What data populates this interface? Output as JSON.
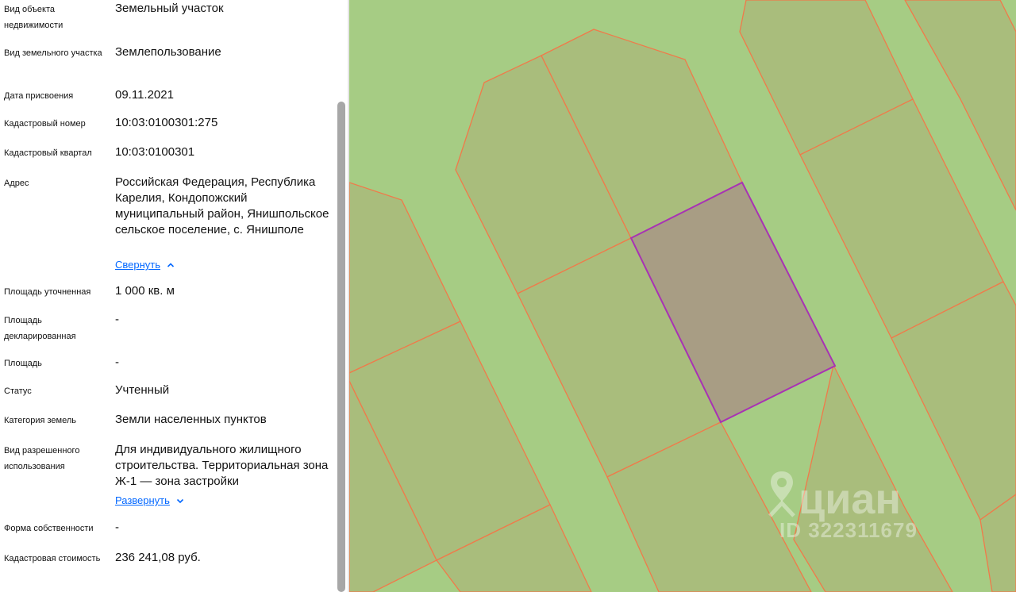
{
  "properties": [
    {
      "label": "Вид объекта недвижимости",
      "value": "Земельный участок"
    },
    {
      "label": "Вид земельного участка",
      "value": "Землепользование"
    },
    {
      "label": "Дата присвоения",
      "value": "09.11.2021"
    },
    {
      "label": "Кадастровый номер",
      "value": "10:03:0100301:275"
    },
    {
      "label": "Кадастровый квартал",
      "value": "10:03:0100301"
    },
    {
      "label": "Адрес",
      "value": "Российская Федерация, Республика Карелия, Кондопожский муниципальный район, Янишпольское сельское поселение, с. Янишполе",
      "toggle": "Свернуть"
    },
    {
      "label": "Площадь уточненная",
      "value": "1 000 кв. м"
    },
    {
      "label": "Площадь декларированная",
      "value": "-"
    },
    {
      "label": "Площадь",
      "value": "-"
    },
    {
      "label": "Статус",
      "value": "Учтенный"
    },
    {
      "label": "Категория земель",
      "value": "Земли населенных пунктов"
    },
    {
      "label": "Вид разрешенного использования",
      "value": "Для индивидуального жилищного строительства. Территориальная зона Ж-1 — зона застройки",
      "toggle": "Развернуть"
    },
    {
      "label": "Форма собственности",
      "value": "-"
    },
    {
      "label": "Кадастровая стоимость",
      "value": "236 241,08 руб."
    }
  ],
  "map": {
    "background_color": "#a6cc84",
    "parcel_fill_color": "#a9bd7c",
    "border_color": "#f07a4a",
    "selected_fill_color": "#a89d84",
    "selected_border_color": "#a832b4"
  },
  "watermark": {
    "brand": "циан",
    "id_text": "ID 322311679",
    "icon": "location-pin-icon"
  }
}
